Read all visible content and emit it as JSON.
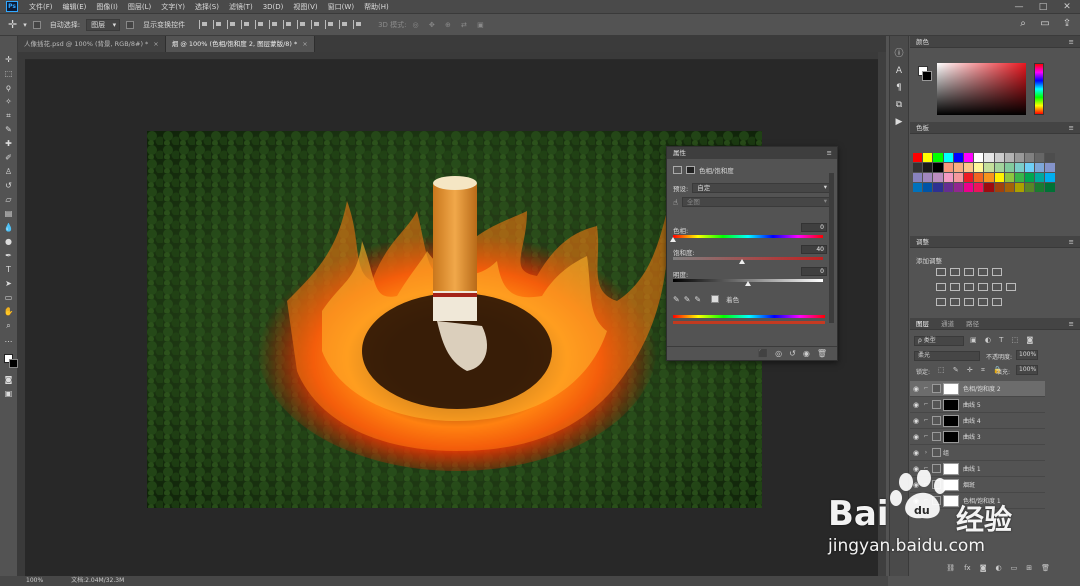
{
  "menubar": {
    "logo": "Ps",
    "items": [
      "文件(F)",
      "编辑(E)",
      "图像(I)",
      "图层(L)",
      "文字(Y)",
      "选择(S)",
      "滤镜(T)",
      "3D(D)",
      "视图(V)",
      "窗口(W)",
      "帮助(H)"
    ],
    "window_controls": [
      "—",
      "□",
      "✕"
    ]
  },
  "options": {
    "auto_select_label": "自动选择:",
    "auto_select_value": "图层",
    "show_transform_label": "显示变换控件",
    "mode_3d_label": "3D 模式:"
  },
  "tabs": [
    {
      "label": "人像插花.psd @ 100% (背景, RGB/8#) *",
      "close": "×"
    },
    {
      "label": "烟 @ 100% (色相/饱和度 2, 图层蒙版/8) *",
      "close": "×"
    }
  ],
  "properties_panel": {
    "title": "属性",
    "menu": "≡",
    "adjust_title": "色相/饱和度",
    "preset_label": "预设:",
    "preset_value": "自定",
    "channel_value": "全图",
    "hue_label": "色相:",
    "hue_value": 0,
    "saturation_label": "饱和度:",
    "saturation_value": 40,
    "lightness_label": "明度:",
    "lightness_value": 0,
    "colorize_label": "着色",
    "hue_pos": 0.0,
    "saturation_pos": 0.46,
    "lightness_pos": 0.5
  },
  "color_panel": {
    "title": "颜色",
    "menu": "≡",
    "fg_color": "#ffffff",
    "bg_color": "#000000"
  },
  "swatches_panel": {
    "title": "色板",
    "menu": "≡"
  },
  "adjustments_panel": {
    "title": "调整",
    "subtitle": "添加调整",
    "menu": "≡"
  },
  "layers_panel": {
    "tabs": [
      "图层",
      "通道",
      "路径"
    ],
    "menu": "≡",
    "filter_label": "ρ 类型",
    "blend_mode": "柔光",
    "opacity_label": "不透明度:",
    "opacity_value": "100%",
    "lock_label": "锁定:",
    "fill_label": "填充:",
    "fill_value": "100%",
    "layers": [
      {
        "name": "色相/饱和度 2",
        "selected": true
      },
      {
        "name": "曲线 5",
        "selected": false
      },
      {
        "name": "曲线 4",
        "selected": false
      },
      {
        "name": "曲线 3",
        "selected": false
      },
      {
        "name": "组",
        "selected": false
      },
      {
        "name": "曲线 1",
        "selected": false
      },
      {
        "name": "烟斑",
        "selected": false
      },
      {
        "name": "色相/饱和度 1",
        "selected": false
      }
    ]
  },
  "statusbar": {
    "zoom": "100%",
    "doc": "文档:2.04M/32.3M"
  },
  "watermark": {
    "brand": "Bai",
    "brand2": "经验",
    "url": "jingyan.baidu.com"
  }
}
